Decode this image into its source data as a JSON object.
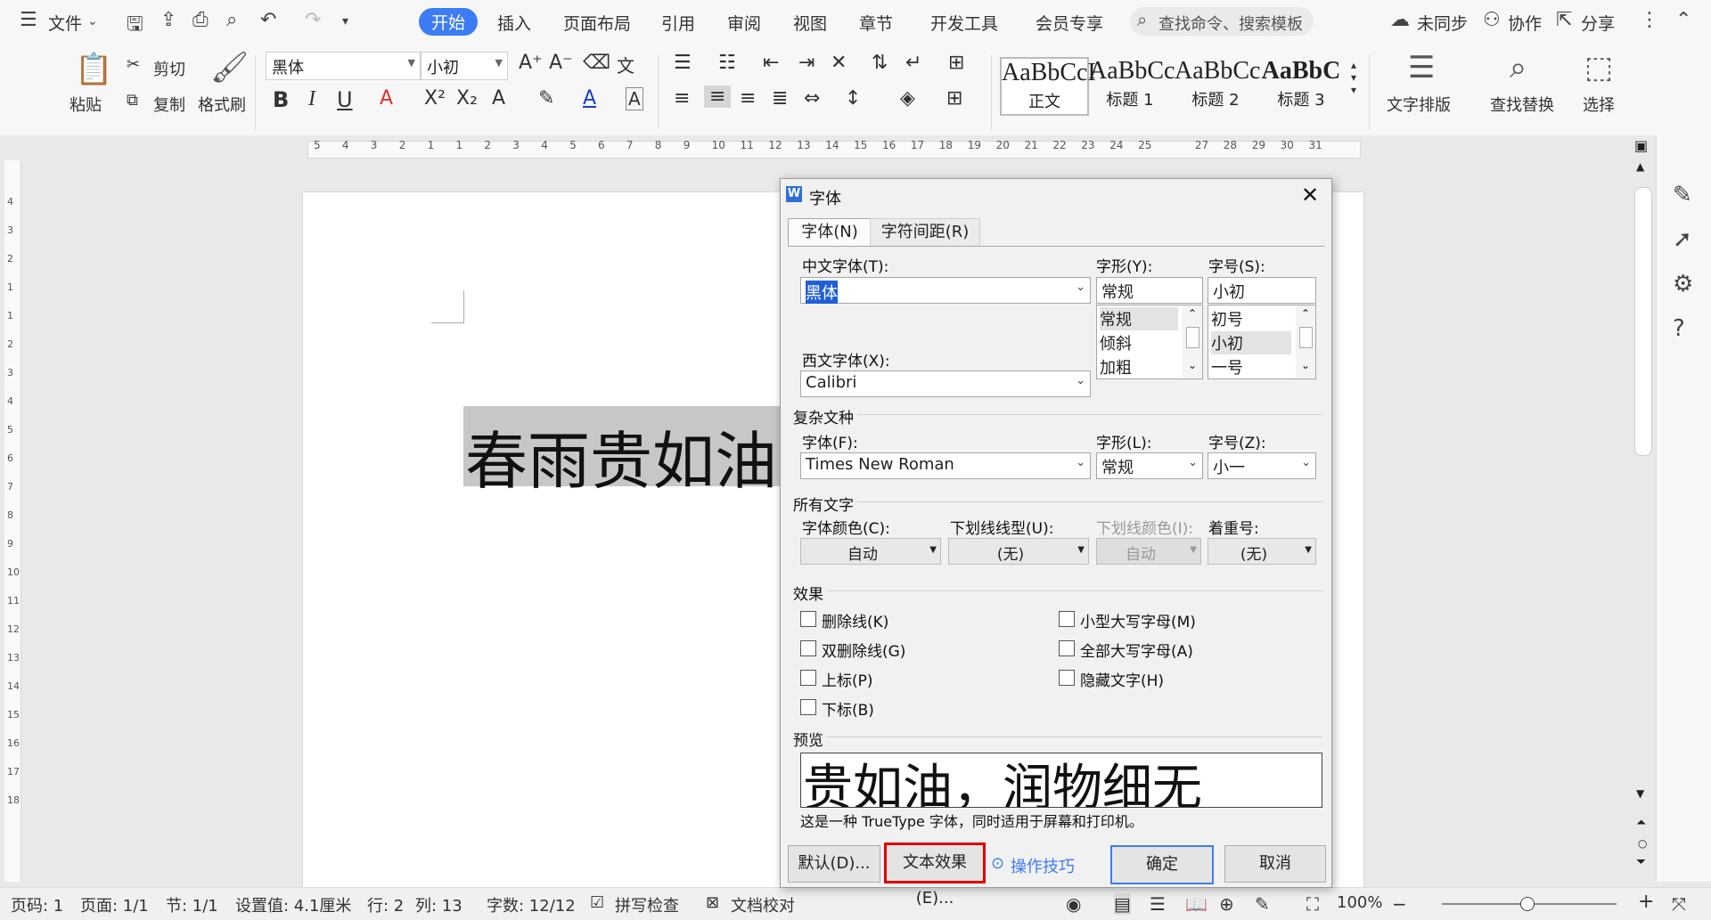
{
  "menubar": {
    "file": "文件",
    "tabs": [
      "开始",
      "插入",
      "页面布局",
      "引用",
      "审阅",
      "视图",
      "章节",
      "开发工具",
      "会员专享"
    ],
    "search_placeholder": "查找命令、搜索模板",
    "sync": "未同步",
    "collab": "协作",
    "share": "分享"
  },
  "ribbon": {
    "paste": "粘贴",
    "cut": "剪切",
    "copy": "复制",
    "format_painter": "格式刷",
    "font_name": "黑体",
    "font_size": "小初",
    "styles": [
      {
        "sample": "AaBbCcI",
        "name": "正文"
      },
      {
        "sample": "AaBbCc",
        "name": "标题 1"
      },
      {
        "sample": "AaBbCc",
        "name": "标题 2"
      },
      {
        "sample": "AaBbC",
        "name": "标题 3"
      }
    ],
    "text_layout": "文字排版",
    "find_replace": "查找替换",
    "select": "选择"
  },
  "ruler": {
    "h_ticks": [
      "5",
      "4",
      "3",
      "2",
      "1",
      "1",
      "2",
      "3",
      "4",
      "5",
      "6",
      "7",
      "8",
      "9",
      "10",
      "11",
      "12",
      "13",
      "14",
      "15",
      "16",
      "17",
      "18",
      "19",
      "20",
      "21",
      "22",
      "23",
      "24",
      "25",
      "27",
      "28",
      "29",
      "30",
      "31"
    ],
    "v_ticks": [
      "4",
      "3",
      "2",
      "1",
      "1",
      "2",
      "3",
      "4",
      "5",
      "6",
      "7",
      "8",
      "9",
      "10",
      "11",
      "12",
      "13",
      "14",
      "15",
      "16",
      "17",
      "18"
    ]
  },
  "document": {
    "text": "春雨贵如油"
  },
  "dialog": {
    "title": "字体",
    "tabs": [
      "字体(N)",
      "字符间距(R)"
    ],
    "cn_font_label": "中文字体(T):",
    "cn_font_value": "黑体",
    "style_label": "字形(Y):",
    "style_value": "常规",
    "style_options": [
      "常规",
      "倾斜",
      "加粗"
    ],
    "size_label": "字号(S):",
    "size_value": "小初",
    "size_options": [
      "初号",
      "小初",
      "一号"
    ],
    "west_font_label": "西文字体(X):",
    "west_font_value": "Calibri",
    "complex_section": "复杂文种",
    "complex_font_label": "字体(F):",
    "complex_font_value": "Times New Roman",
    "complex_style_label": "字形(L):",
    "complex_style_value": "常规",
    "complex_size_label": "字号(Z):",
    "complex_size_value": "小一",
    "all_text_section": "所有文字",
    "color_label": "字体颜色(C):",
    "color_value": "自动",
    "underline_label": "下划线线型(U):",
    "underline_value": "(无)",
    "underline_color_label": "下划线颜色(I):",
    "underline_color_value": "自动",
    "emphasis_label": "着重号:",
    "emphasis_value": "(无)",
    "effects_section": "效果",
    "effects": [
      "删除线(K)",
      "双删除线(G)",
      "上标(P)",
      "下标(B)",
      "小型大写字母(M)",
      "全部大写字母(A)",
      "隐藏文字(H)"
    ],
    "preview_section": "预览",
    "preview_text": "贵如油，润物细无",
    "preview_note": "这是一种 TrueType 字体，同时适用于屏幕和打印机。",
    "btn_default": "默认(D)...",
    "btn_text_effect": "文本效果(E)...",
    "tips": "操作技巧",
    "btn_ok": "确定",
    "btn_cancel": "取消"
  },
  "status": {
    "page_code": "页码: 1",
    "page": "页面: 1/1",
    "section": "节: 1/1",
    "setting": "设置值: 4.1厘米",
    "row": "行: 2",
    "col": "列: 13",
    "word_count": "字数: 12/12",
    "spell": "拼写检查",
    "proof": "文档校对",
    "zoom": "100%"
  },
  "colors": {
    "accent": "#3c7cf5",
    "highlight_border": "#e00000",
    "selection": "#c7c7c7"
  }
}
